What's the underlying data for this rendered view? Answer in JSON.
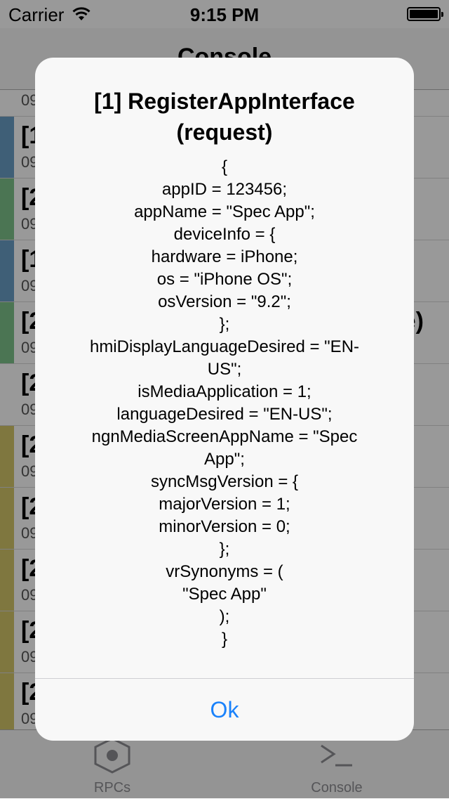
{
  "status_bar": {
    "carrier": "Carrier",
    "time": "9:15 PM",
    "wifi_icon": "wifi-icon",
    "battery_icon": "battery-icon"
  },
  "navbar": {
    "title": "Console"
  },
  "rows": [
    {
      "title": "",
      "sub": "09",
      "color": "#ffffff"
    },
    {
      "title": "[1",
      "sub": "09",
      "color": "#6a9ec7"
    },
    {
      "title": "[2",
      "sub": "09",
      "color": "#7ec48b"
    },
    {
      "title": "[1",
      "sub": "09",
      "color": "#6a9ec7"
    },
    {
      "title": "[2",
      "sub": "09",
      "color": "#7ec48b",
      "tail": "e)"
    },
    {
      "title": "[2",
      "sub": "09",
      "color": "#ffffff"
    },
    {
      "title": "[2",
      "sub": "09",
      "color": "#d4c66a"
    },
    {
      "title": "[2",
      "sub": "09",
      "color": "#d4c66a"
    },
    {
      "title": "[2",
      "sub": "09",
      "color": "#d4c66a"
    },
    {
      "title": "[2",
      "sub": "09",
      "color": "#d4c66a"
    },
    {
      "title": "[2",
      "sub": "09",
      "color": "#d4c66a"
    }
  ],
  "tabbar": {
    "tabs": [
      {
        "label": "RPCs",
        "icon": "hexagon-icon"
      },
      {
        "label": "Console",
        "icon": "terminal-icon"
      }
    ]
  },
  "alert": {
    "title": "[1] RegisterAppInterface (request)",
    "message_lines": [
      "{",
      "appID = 123456;",
      "appName = \"Spec App\";",
      "deviceInfo = {",
      "hardware = iPhone;",
      "os = \"iPhone OS\";",
      "osVersion = \"9.2\";",
      "};",
      "hmiDisplayLanguageDesired = \"EN-",
      "US\";",
      "isMediaApplication = 1;",
      "languageDesired = \"EN-US\";",
      "ngnMediaScreenAppName = \"Spec",
      "App\";",
      "syncMsgVersion = {",
      "majorVersion = 1;",
      "minorVersion = 0;",
      "};",
      "vrSynonyms = (",
      "\"Spec App\"",
      ");",
      "}"
    ],
    "ok_label": "Ok"
  }
}
